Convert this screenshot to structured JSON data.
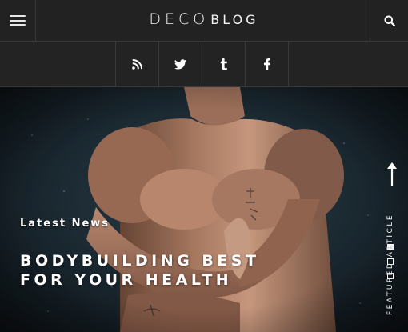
{
  "header": {
    "logo_main": "DECO",
    "logo_sub": "BLOG",
    "menu_icon": "hamburger-menu-icon",
    "search_icon": "search-icon"
  },
  "social": {
    "items": [
      {
        "icon": "rss-icon"
      },
      {
        "icon": "twitter-icon"
      },
      {
        "icon": "tumblr-icon"
      },
      {
        "icon": "facebook-icon"
      }
    ]
  },
  "hero": {
    "category": "Latest News",
    "title": "BODYBUILDING BEST FOR YOUR HEALTH",
    "featured_label": "FEATURED ARTICLE",
    "slides_total": 3,
    "active_slide": 1,
    "scroll_icon": "arrow-up-icon"
  },
  "colors": {
    "header_bg": "#222222",
    "border": "#3a3a3a",
    "text": "#ffffff"
  }
}
